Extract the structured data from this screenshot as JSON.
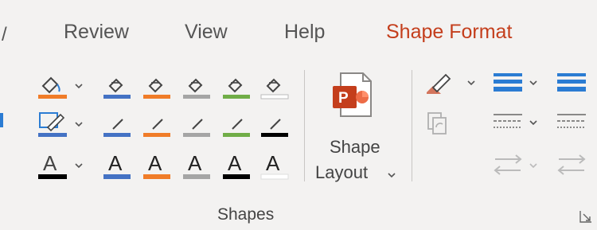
{
  "tabs": [
    {
      "label": "Review",
      "active": false
    },
    {
      "label": "View",
      "active": false
    },
    {
      "label": "Help",
      "active": false
    },
    {
      "label": "Shape Format",
      "active": true
    }
  ],
  "shape_styles": {
    "fill_colors": [
      "#f07c28",
      "#4472c4",
      "#f07c28",
      "#a5a5a5",
      "#70ad47",
      "#ffffff"
    ],
    "outline_colors": [
      "#4472c4",
      "#4472c4",
      "#f07c28",
      "#a5a5a5",
      "#70ad47",
      "#000000"
    ],
    "text_colors": [
      "#000000",
      "#4472c4",
      "#f07c28",
      "#a5a5a5",
      "#000000",
      "#ffffff"
    ],
    "text_letter": "A"
  },
  "shape_layout": {
    "line1": "Shape",
    "line2": "Layout",
    "icon": "powerpoint-shape-icon"
  },
  "group_label": "Shapes",
  "colors": {
    "accent": "#c43e1c",
    "ppt_red": "#c43e1c",
    "arrange_blue": "#2b7cd3"
  }
}
